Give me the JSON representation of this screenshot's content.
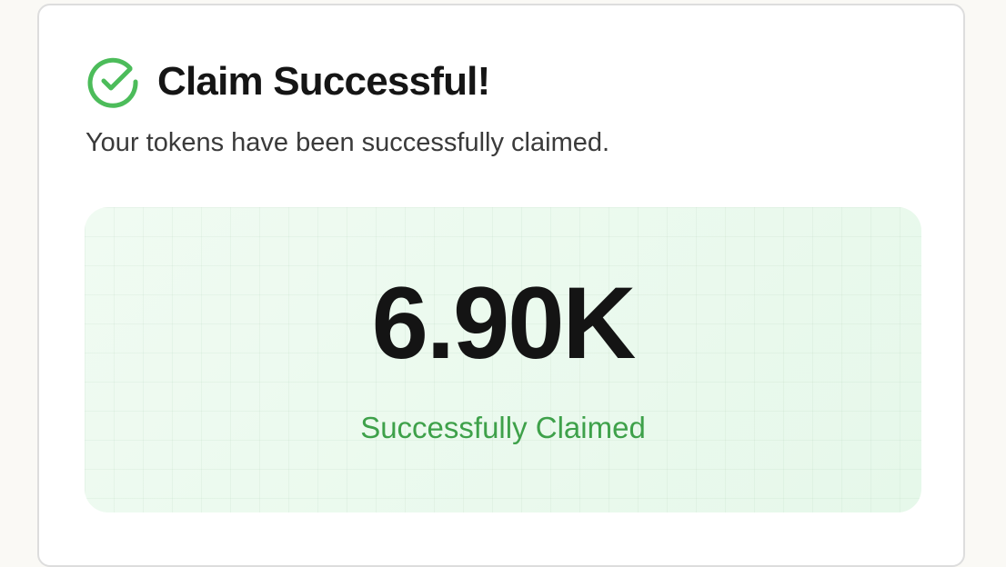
{
  "dialog": {
    "title": "Claim Successful!",
    "subtitle": "Your tokens have been successfully claimed.",
    "icon": "check-circle-icon"
  },
  "claim": {
    "amount": "6.90K",
    "status": "Successfully Claimed"
  },
  "colors": {
    "accent_green": "#4cbc5a",
    "status_green": "#3ea14a",
    "panel_background": "#ecfbef",
    "title_text": "#151515",
    "card_border": "#dddddd"
  }
}
